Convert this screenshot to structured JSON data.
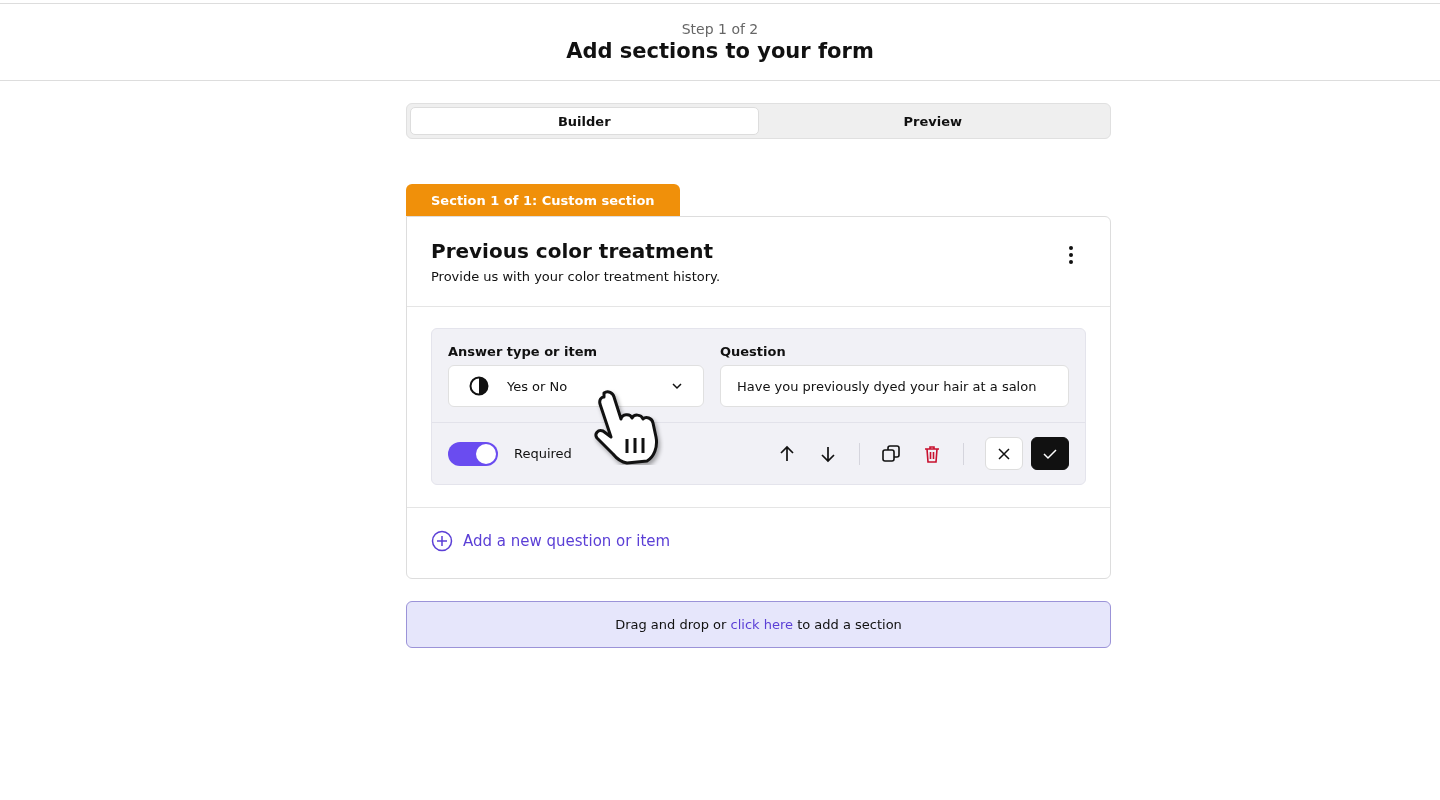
{
  "header": {
    "step": "Step 1 of 2",
    "title": "Add sections to your form"
  },
  "tabs": [
    {
      "label": "Builder",
      "selected": true
    },
    {
      "label": "Preview",
      "selected": false
    }
  ],
  "section": {
    "tab_label": "Section 1 of 1: Custom section",
    "title": "Previous color treatment",
    "description": "Provide us with your color treatment history.",
    "question": {
      "answer_type_label": "Answer type or item",
      "answer_type": "Yes or No",
      "question_label": "Question",
      "question_value": "Have you previously dyed your hair at a salon",
      "required": {
        "label": "Required",
        "on": true
      }
    },
    "add_item": "Add a new question or item"
  },
  "drop_zone": {
    "prefix": "Drag and drop or",
    "link": "click here",
    "suffix": "to add a section"
  }
}
